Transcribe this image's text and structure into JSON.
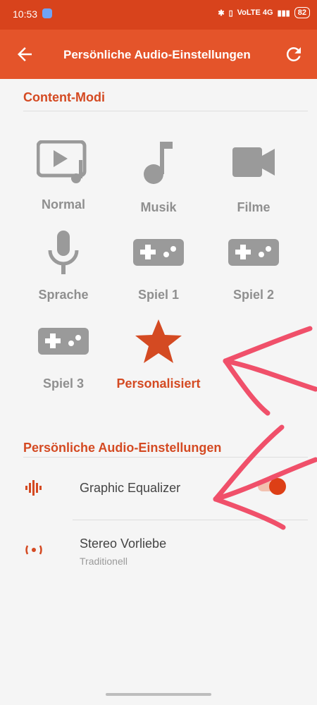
{
  "status": {
    "time": "10:53",
    "network": "VoLTE 4G",
    "battery": "82"
  },
  "appbar": {
    "title": "Persönliche Audio-Einstellungen"
  },
  "section1": {
    "title": "Content-Modi"
  },
  "modes": [
    {
      "name": "Normal",
      "icon": "video-music-icon"
    },
    {
      "name": "Musik",
      "icon": "music-note-icon"
    },
    {
      "name": "Filme",
      "icon": "video-camera-icon"
    },
    {
      "name": "Sprache",
      "icon": "microphone-icon"
    },
    {
      "name": "Spiel 1",
      "icon": "gamepad-icon"
    },
    {
      "name": "Spiel 2",
      "icon": "gamepad-icon"
    },
    {
      "name": "Spiel 3",
      "icon": "gamepad-icon"
    },
    {
      "name": "Personalisiert",
      "icon": "star-icon",
      "active": true
    }
  ],
  "section2": {
    "title": "Persönliche Audio-Einstellungen"
  },
  "settings": [
    {
      "title": "Graphic Equalizer",
      "icon": "equalizer-icon",
      "toggle": true
    },
    {
      "title": "Stereo Vorliebe",
      "subtitle": "Traditionell",
      "icon": "stereo-icon"
    }
  ],
  "colors": {
    "accent": "#e4542a",
    "accent_dark": "#d44a22",
    "icon_gray": "#9a9a9a"
  }
}
